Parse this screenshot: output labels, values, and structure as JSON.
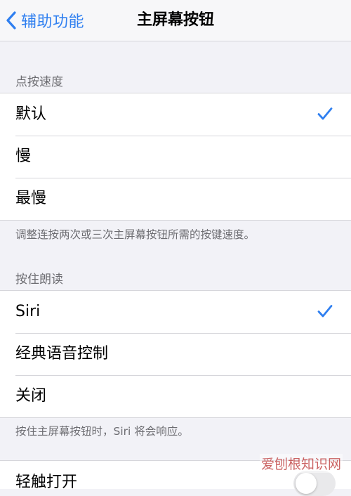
{
  "navbar": {
    "back_label": "辅助功能",
    "title": "主屏幕按钮"
  },
  "click_speed": {
    "header": "点按速度",
    "options": [
      {
        "label": "默认",
        "selected": true
      },
      {
        "label": "慢",
        "selected": false
      },
      {
        "label": "最慢",
        "selected": false
      }
    ],
    "footer": "调整连按两次或三次主屏幕按钮所需的按键速度。"
  },
  "press_to_speak": {
    "header": "按住朗读",
    "options": [
      {
        "label": "Siri",
        "selected": true
      },
      {
        "label": "经典语音控制",
        "selected": false
      },
      {
        "label": "关闭",
        "selected": false
      }
    ],
    "footer": "按住主屏幕按钮时，Siri 将会响应。"
  },
  "partial_row": {
    "label": "轻触打开"
  },
  "watermark": "爱刨根知识网",
  "colors": {
    "accent": "#2f7ff0",
    "background": "#f2f2f7",
    "separator": "#d6d6db",
    "secondary_text": "#6d6d72"
  },
  "icons": {
    "back": "chevron-left-icon",
    "selected": "checkmark-icon"
  }
}
